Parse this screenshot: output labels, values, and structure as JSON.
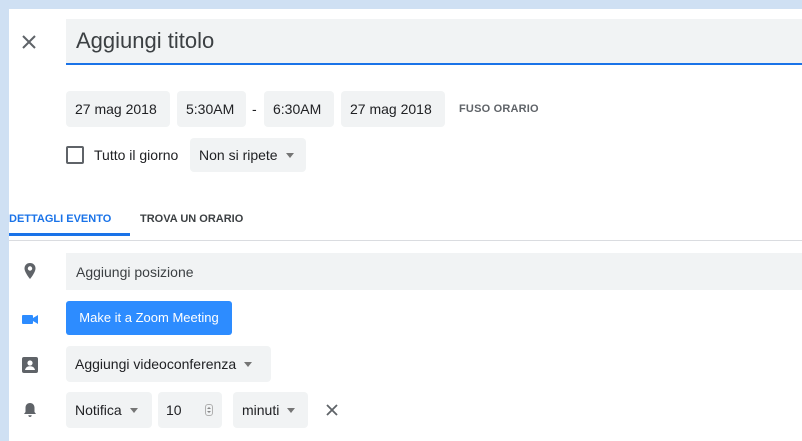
{
  "title": {
    "placeholder": "Aggiungi titolo"
  },
  "datetime": {
    "start_date": "27 mag 2018",
    "start_time": "5:30AM",
    "separator": "-",
    "end_time": "6:30AM",
    "end_date": "27 mag 2018",
    "timezone_link": "FUSO ORARIO"
  },
  "options": {
    "all_day_label": "Tutto il giorno",
    "all_day_checked": false,
    "repeat_value": "Non si ripete"
  },
  "tabs": [
    {
      "label": "DETTAGLI EVENTO",
      "active": true
    },
    {
      "label": "TROVA UN ORARIO",
      "active": false
    }
  ],
  "details": {
    "location_placeholder": "Aggiungi posizione",
    "zoom_button": "Make it a Zoom Meeting",
    "conference_value": "Aggiungi videoconferenza",
    "notification": {
      "type": "Notifica",
      "amount": "10",
      "unit": "minuti"
    }
  },
  "icons": {
    "close": "close-icon",
    "location": "location-pin-icon",
    "video": "video-camera-icon",
    "conference": "contact-card-icon",
    "notification": "bell-icon",
    "remove_notification": "close-icon"
  },
  "colors": {
    "accent": "#1a73e8",
    "zoom": "#2d8cff",
    "field_bg": "#f1f3f4",
    "page_border": "#cfe0f3"
  }
}
